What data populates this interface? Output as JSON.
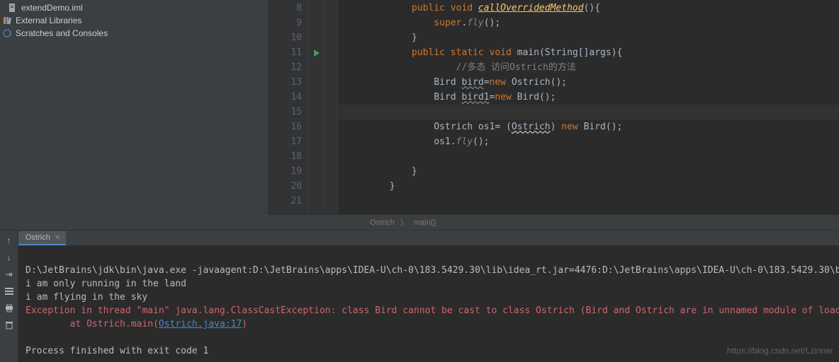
{
  "sidebar": {
    "items": [
      {
        "icon": "iml",
        "label": "extendDemo.iml"
      },
      {
        "icon": "lib",
        "label": "External Libraries"
      },
      {
        "icon": "scratch",
        "label": "Scratches and Consoles"
      }
    ]
  },
  "editor": {
    "startLine": 8,
    "runLine": 11,
    "highlightLine": 15,
    "lines": [
      {
        "n": 8,
        "tokens": [
          [
            "kw",
            "public void "
          ],
          [
            "method",
            "callOverridedMethod"
          ],
          [
            "plain",
            "(){"
          ]
        ],
        "indent": 12
      },
      {
        "n": 9,
        "tokens": [
          [
            "kw",
            "super"
          ],
          [
            "plain",
            "."
          ],
          [
            "cn",
            "fly"
          ],
          [
            "plain",
            "();"
          ]
        ],
        "indent": 16
      },
      {
        "n": 10,
        "tokens": [
          [
            "plain",
            "}"
          ]
        ],
        "indent": 12
      },
      {
        "n": 11,
        "tokens": [
          [
            "kw",
            "public static void "
          ],
          [
            "plain",
            "main(String[]args){"
          ]
        ],
        "indent": 12
      },
      {
        "n": 12,
        "tokens": [
          [
            "comment",
            "//多态 访问Ostrich的方法"
          ]
        ],
        "indent": 20
      },
      {
        "n": 13,
        "tokens": [
          [
            "plain",
            "Bird "
          ],
          [
            "warn2",
            "bird"
          ],
          [
            "plain",
            "="
          ],
          [
            "kw",
            "new "
          ],
          [
            "plain",
            "Ostrich();"
          ]
        ],
        "indent": 16
      },
      {
        "n": 14,
        "tokens": [
          [
            "plain",
            "Bird "
          ],
          [
            "warn2",
            "bird1"
          ],
          [
            "plain",
            "="
          ],
          [
            "kw",
            "new "
          ],
          [
            "plain",
            "Bird();"
          ]
        ],
        "indent": 16
      },
      {
        "n": 15,
        "tokens": [
          [
            "plain",
            ""
          ]
        ],
        "indent": 16
      },
      {
        "n": 16,
        "tokens": [
          [
            "plain",
            "Ostrich os1= ("
          ],
          [
            "warn",
            "Ostrich"
          ],
          [
            "plain",
            ") "
          ],
          [
            "kw",
            "new "
          ],
          [
            "plain",
            "Bird();"
          ]
        ],
        "indent": 16
      },
      {
        "n": 17,
        "tokens": [
          [
            "plain",
            "os1."
          ],
          [
            "cn",
            "fly"
          ],
          [
            "plain",
            "();"
          ]
        ],
        "indent": 16
      },
      {
        "n": 18,
        "tokens": [
          [
            "plain",
            ""
          ]
        ],
        "indent": 16
      },
      {
        "n": 19,
        "tokens": [
          [
            "plain",
            "}"
          ]
        ],
        "indent": 12
      },
      {
        "n": 20,
        "tokens": [
          [
            "plain",
            "}"
          ]
        ],
        "indent": 8
      },
      {
        "n": 21,
        "tokens": [
          [
            "plain",
            ""
          ]
        ],
        "indent": 0
      }
    ]
  },
  "breadcrumb": {
    "class": "Ostrich",
    "method": "main()"
  },
  "runTab": {
    "label": "Ostrich"
  },
  "console": {
    "cmd": "D:\\JetBrains\\jdk\\bin\\java.exe -javaagent:D:\\JetBrains\\apps\\IDEA-U\\ch-0\\183.5429.30\\lib\\idea_rt.jar=4476:D:\\JetBrains\\apps\\IDEA-U\\ch-0\\183.5429.30\\bin -Dfile.encoding=UTF-",
    "out1": "i am only running in the land",
    "out2": "i am flying in the sky",
    "err1": "Exception in thread \"main\" java.lang.ClassCastException: class Bird cannot be cast to class Ostrich (Bird and Ostrich are in unnamed module of loader 'app')",
    "err2_pre": "\tat Ostrich.main(",
    "err2_link": "Ostrich.java:17",
    "err2_post": ")",
    "exit": "Process finished with exit code 1"
  },
  "watermark": "https://blog.csdn.net/Lzinner"
}
